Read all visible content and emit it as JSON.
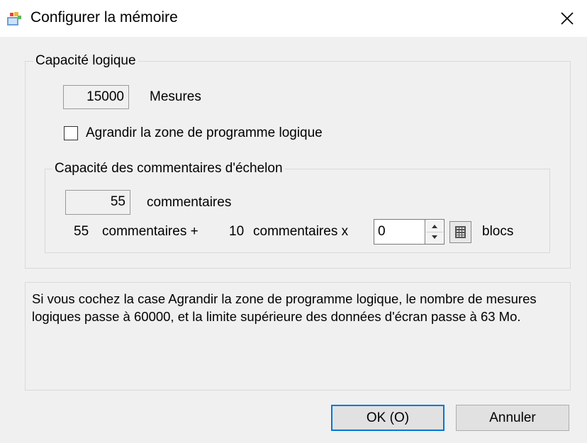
{
  "window": {
    "title": "Configurer la mémoire",
    "icon": "memory-config-icon",
    "close_icon": "close-icon"
  },
  "logic_capacity": {
    "legend": "Capacité logique",
    "measures_value": "15000",
    "measures_label": "Mesures",
    "expand_checkbox_label": "Agrandir la zone de programme logique",
    "expand_checked": false
  },
  "comments_capacity": {
    "legend": "Capacité des commentaires d'échelon",
    "count_value": "55",
    "count_label": "commentaires",
    "base_count": "55",
    "base_label": "commentaires +",
    "block_size": "10",
    "block_label": "commentaires x",
    "blocks_value": "0",
    "blocks_label": "blocs"
  },
  "info_text": "Si vous cochez la case Agrandir la zone de programme logique, le nombre de mesures logiques passe à 60000, et la limite supérieure des données d'écran passe à 63 Mo.",
  "buttons": {
    "ok": "OK (O)",
    "cancel": "Annuler"
  }
}
